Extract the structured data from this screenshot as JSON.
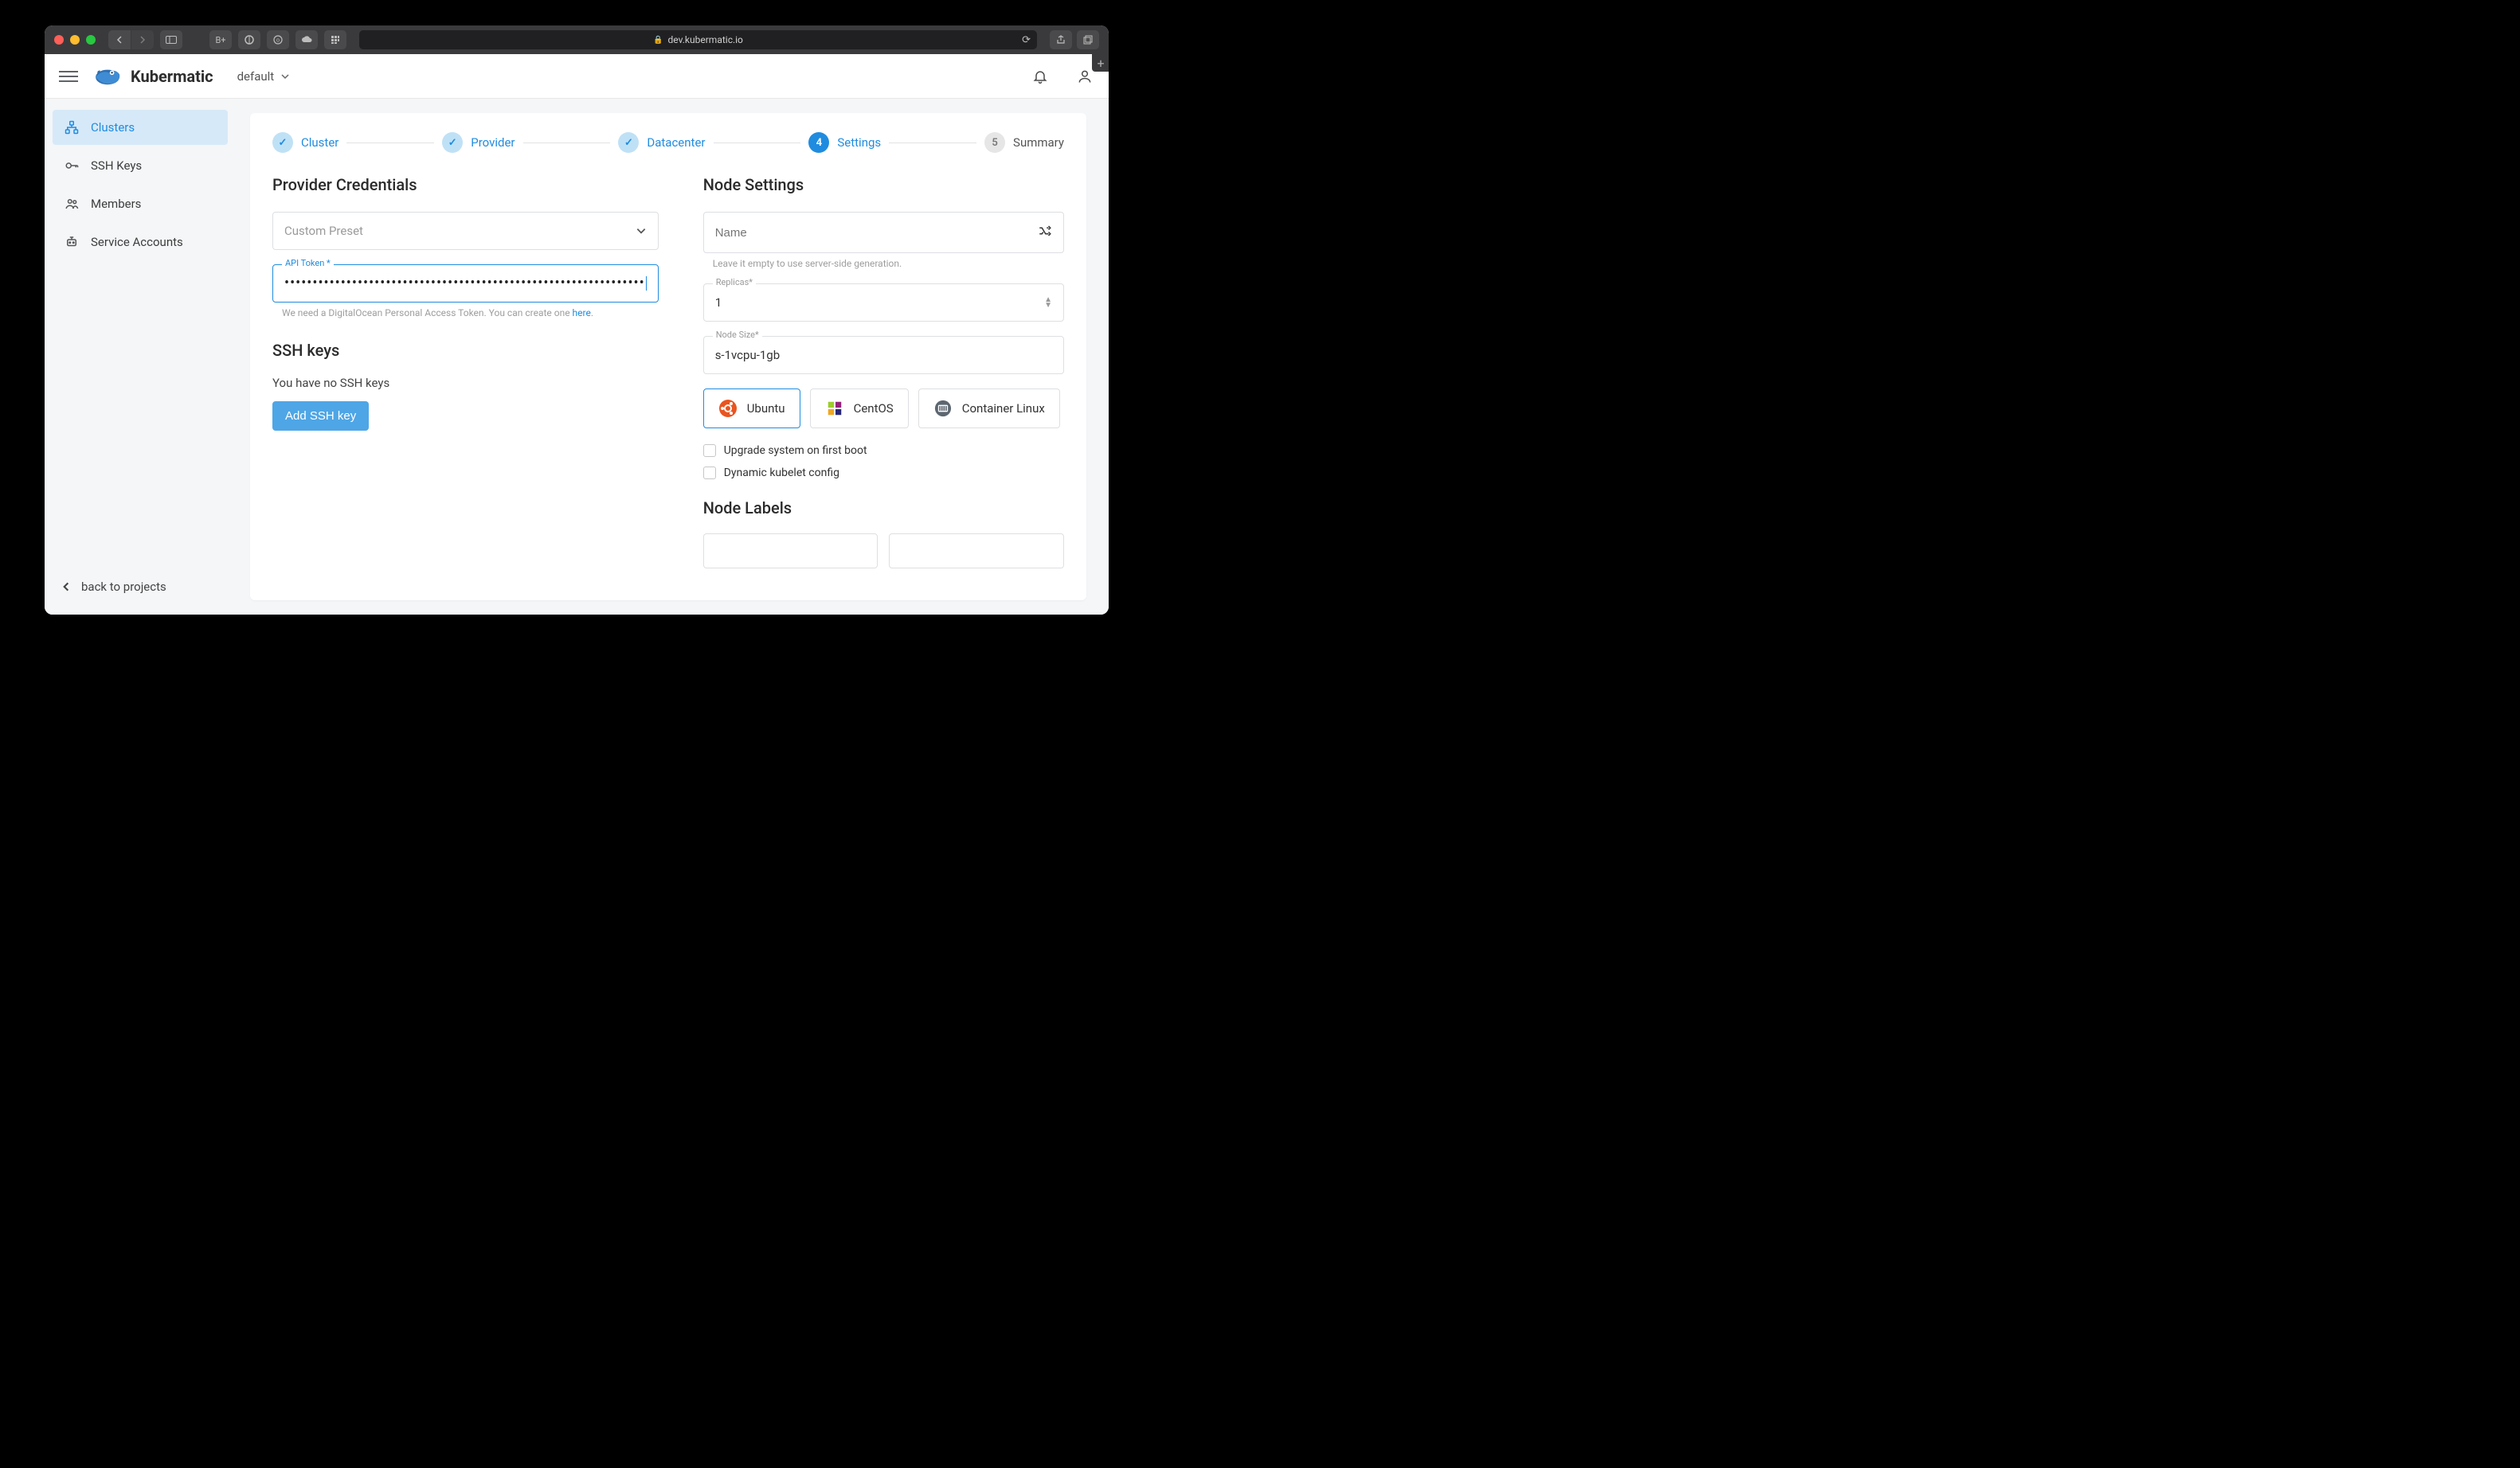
{
  "browser": {
    "address": "dev.kubermatic.io",
    "lock": "🔒"
  },
  "header": {
    "brand": "Kubermatic",
    "project": "default"
  },
  "sidebar": {
    "items": [
      {
        "label": "Clusters"
      },
      {
        "label": "SSH Keys"
      },
      {
        "label": "Members"
      },
      {
        "label": "Service Accounts"
      }
    ],
    "back": "back to projects"
  },
  "stepper": {
    "steps": [
      {
        "label": "Cluster",
        "state": "done",
        "mark": "✓"
      },
      {
        "label": "Provider",
        "state": "done",
        "mark": "✓"
      },
      {
        "label": "Datacenter",
        "state": "done",
        "mark": "✓"
      },
      {
        "label": "Settings",
        "state": "active",
        "mark": "4"
      },
      {
        "label": "Summary",
        "state": "pending",
        "mark": "5"
      }
    ]
  },
  "left": {
    "title": "Provider Credentials",
    "preset_placeholder": "Custom Preset",
    "api_token": {
      "label": "API Token *",
      "value": "••••••••••••••••••••••••••••••••••••••••••••••••••••••••••••••••",
      "helper_prefix": "We need a DigitalOcean Personal Access Token. You can create one ",
      "helper_link": "here",
      "helper_suffix": "."
    },
    "ssh_title": "SSH keys",
    "ssh_empty": "You have no SSH keys",
    "add_ssh": "Add SSH key"
  },
  "right": {
    "title": "Node Settings",
    "name_placeholder": "Name",
    "name_helper": "Leave it empty to use server-side generation.",
    "replicas_label": "Replicas*",
    "replicas_value": "1",
    "size_label": "Node Size*",
    "size_value": "s-1vcpu-1gb",
    "os": [
      {
        "label": "Ubuntu",
        "selected": true
      },
      {
        "label": "CentOS",
        "selected": false
      },
      {
        "label": "Container Linux",
        "selected": false
      }
    ],
    "chk_upgrade": "Upgrade system on first boot",
    "chk_dynamic": "Dynamic kubelet config",
    "labels_title": "Node Labels"
  }
}
